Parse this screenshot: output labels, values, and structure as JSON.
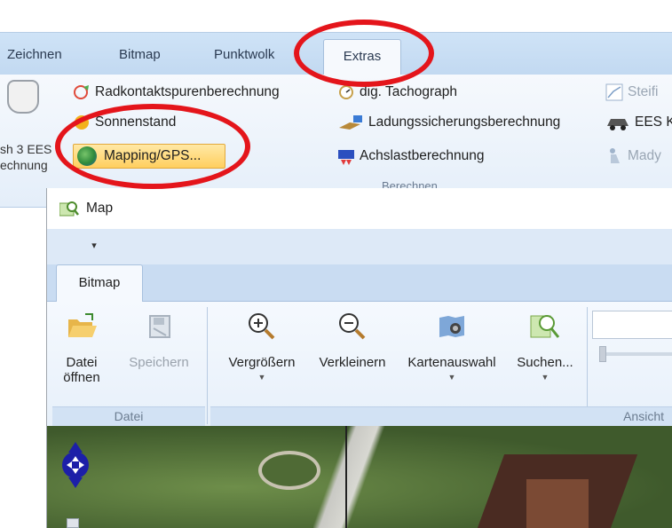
{
  "main_ribbon": {
    "tabs": [
      "Zeichnen",
      "Bitmap",
      "Punktwolk",
      "Extras"
    ],
    "active_tab": "Extras",
    "left_big_button": {
      "label_line1": "sh 3 EES",
      "label_line2": "echnung",
      "icon": "crash-car-icon"
    },
    "items": {
      "radkontakt": "Radkontaktspurenberechnung",
      "sonnenstand": "Sonnenstand",
      "mapping": "Mapping/GPS...",
      "tachograph": "dig. Tachograph",
      "ladung": "Ladungssicherungsberechnung",
      "achslast": "Achslastberechnung",
      "steif": "Steifi",
      "ees": "EES K",
      "mady": "Mady"
    },
    "group_label": "Berechnen"
  },
  "map_window": {
    "title": "Map",
    "qat_button": "▾",
    "tab": "Bitmap",
    "groups": {
      "datei": {
        "label": "Datei",
        "open_line1": "Datei",
        "open_line2": "öffnen",
        "save": "Speichern"
      },
      "ansicht": {
        "label": "Ansicht",
        "zoom_in": "Vergrößern",
        "zoom_out": "Verkleinern",
        "map_select": "Kartenauswahl",
        "search": "Suchen..."
      }
    }
  },
  "colors": {
    "annotation": "#e4151b",
    "ribbon_blue": "#c9dcf2",
    "highlight": "#ffcf5e"
  }
}
